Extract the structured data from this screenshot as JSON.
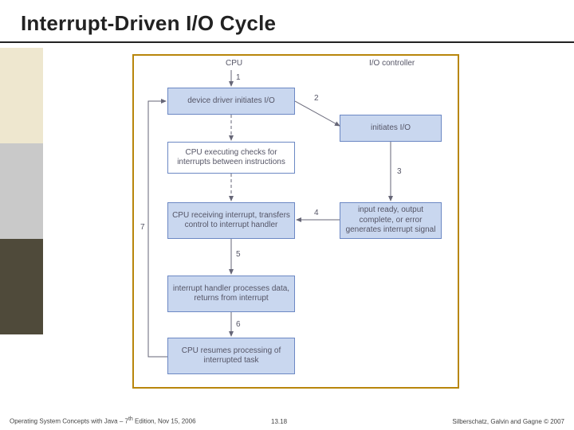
{
  "title": "Interrupt-Driven I/O Cycle",
  "accent_colors": {
    "a": "#eee7cf",
    "b": "#c9c9c9",
    "c": "#4f4a3a"
  },
  "columns": {
    "cpu": "CPU",
    "io": "I/O controller"
  },
  "boxes": {
    "b1": "device driver initiates I/O",
    "b2": "initiates I/O",
    "b3": "CPU executing checks for interrupts between instructions",
    "b4": "CPU receiving interrupt, transfers control to interrupt handler",
    "b5": "input ready, output complete, or error generates interrupt signal",
    "b6": "interrupt handler processes data, returns from interrupt",
    "b7": "CPU resumes processing of interrupted task"
  },
  "edge_labels": {
    "e1": "1",
    "e2": "2",
    "e3": "3",
    "e4": "4",
    "e5": "5",
    "e6": "6",
    "e7": "7"
  },
  "footer": {
    "left_a": "Operating System Concepts with Java – 7",
    "left_sup": "th",
    "left_b": " Edition, Nov 15, 2006",
    "mid": "13.18",
    "right": "Silberschatz, Galvin and Gagne © 2007"
  }
}
